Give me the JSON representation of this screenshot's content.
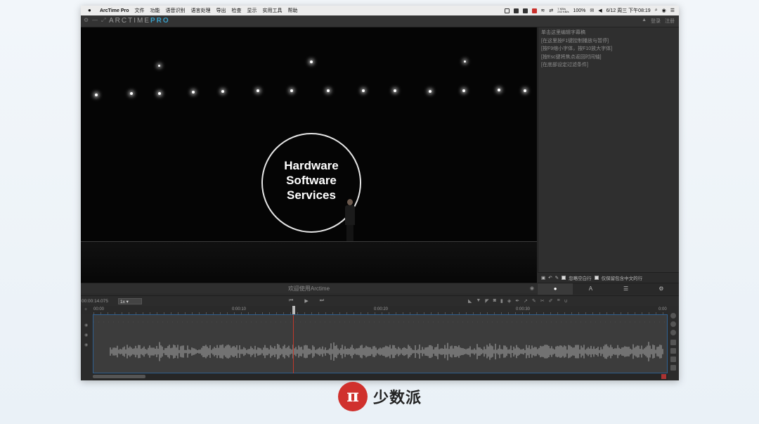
{
  "menubar": {
    "apple": "",
    "items": [
      "ArcTime Pro",
      "文件",
      "功能",
      "语音识别",
      "语言处理",
      "导出",
      "检查",
      "显示",
      "实用工具",
      "帮助"
    ],
    "battery": "100%",
    "datetime": "6/12 周三 下午08:19",
    "net_up": "7 KB/s",
    "net_down": "242 KB/s"
  },
  "app": {
    "logo_text": "ARCTIME",
    "logo_accent": "PRO",
    "login": "登录",
    "register": "注册"
  },
  "video": {
    "slide_lines": [
      "Hardware",
      "Software",
      "Services"
    ]
  },
  "caption_bar": {
    "text": "欢迎使用Arctime"
  },
  "sidebar": {
    "lines": [
      "单击这里编辑字幕稿",
      "[在这里按F1键控制播放与暂停]",
      "[按F9缩小字体，按F10放大字体]",
      "[按Esc键将焦点返回时间轴]",
      "[在底部设定过滤条件]"
    ],
    "opt_ignore_blank": "忽略空白行",
    "opt_keep_chinese": "仅保留包含中文的行"
  },
  "transport": {
    "time": "00:00:14.075",
    "speed": "1x"
  },
  "ruler": {
    "labels": [
      "00:00",
      "0:00:10",
      "0:00:20",
      "0:00:30",
      "0:00"
    ]
  },
  "brand": {
    "mark": "π",
    "name": "少数派"
  },
  "colors": {
    "accent": "#3aa0c8",
    "brand_red": "#d0312d",
    "playhead": "#c0392b"
  }
}
